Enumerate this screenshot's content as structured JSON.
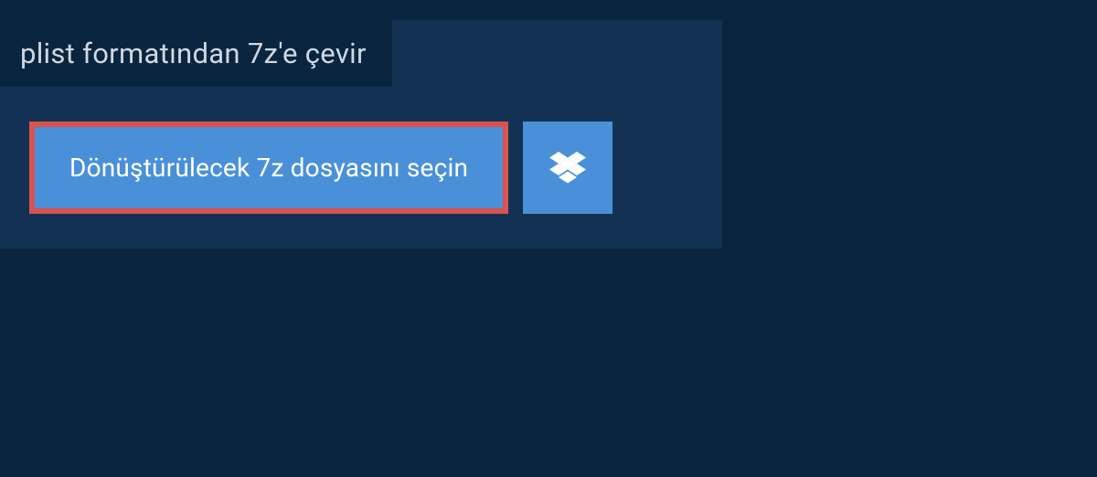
{
  "title": "plist formatından 7z'e çevir",
  "select_button_label": "Dönüştürülecek 7z dosyasını seçin",
  "dropbox_icon_name": "dropbox-icon",
  "colors": {
    "background": "#0a2540",
    "panel": "#133253",
    "button": "#4a90d9",
    "button_border": "#d9534f",
    "text_light": "#d0d8e0",
    "text_white": "#ffffff"
  }
}
